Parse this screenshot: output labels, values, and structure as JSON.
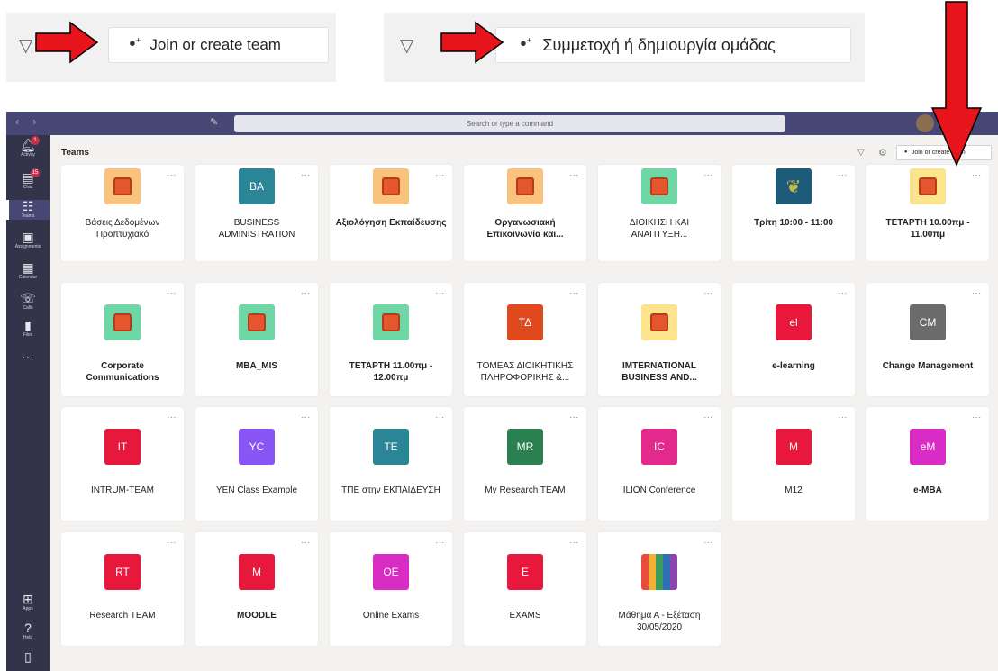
{
  "callouts": {
    "english": {
      "button_label": "Join or create team",
      "button_icon": "people-add-icon",
      "filter_icon": "filter-icon"
    },
    "greek": {
      "button_label": "Συμμετοχή ή δημιουργία ομάδας",
      "button_icon": "people-add-icon",
      "filter_icon": "filter-icon"
    }
  },
  "annotation_color": "#e8141b",
  "titlebar": {
    "search_placeholder": "Search or type a command",
    "background": "#464775"
  },
  "rail": {
    "items": [
      {
        "label": "Activity",
        "icon": "bell-icon",
        "badge": "1"
      },
      {
        "label": "Chat",
        "icon": "chat-icon",
        "badge": "15"
      },
      {
        "label": "Teams",
        "icon": "teams-icon",
        "active": true
      },
      {
        "label": "Assignments",
        "icon": "assignments-icon"
      },
      {
        "label": "Calendar",
        "icon": "calendar-icon"
      },
      {
        "label": "Calls",
        "icon": "phone-icon"
      },
      {
        "label": "Files",
        "icon": "file-icon"
      },
      {
        "label": "...",
        "icon": "more-icon"
      },
      {
        "label": "Apps",
        "icon": "apps-icon"
      },
      {
        "label": "Help",
        "icon": "help-icon"
      },
      {
        "label": "",
        "icon": "device-icon"
      }
    ]
  },
  "main": {
    "title": "Teams",
    "join_button": "Join or create team",
    "more_label": "...",
    "teams": [
      {
        "name": "Βάσεις Δεδομένων Προπτυχιακό",
        "tile": "icon",
        "color": "#f9c37e",
        "bold": false
      },
      {
        "name": "BUSINESS ADMINISTRATION",
        "tile": "text",
        "initials": "BA",
        "color": "#2a8597",
        "bold": false
      },
      {
        "name": "Αξιολόγηση Εκπαίδευσης",
        "tile": "icon",
        "color": "#f9c37e",
        "bold": true
      },
      {
        "name": "Οργανωσιακή Επικοινωνία και...",
        "tile": "icon",
        "color": "#f9c37e",
        "bold": true
      },
      {
        "name": "ΔΙΟΙΚΗΣΗ ΚΑΙ ΑΝΑΠΤΥΞΗ...",
        "tile": "icon",
        "color": "#6fd7a6",
        "bold": false
      },
      {
        "name": "Τρίτη 10:00 - 11:00",
        "tile": "image",
        "color": "#1e5a7a",
        "bold": true
      },
      {
        "name": "ΤΕΤΑΡΤΗ 10.00πμ - 11.00πμ",
        "tile": "icon",
        "color": "#fbe48c",
        "bold": true
      },
      {
        "name": "Corporate Communications",
        "tile": "icon",
        "color": "#6fd7a6",
        "bold": true
      },
      {
        "name": "MBA_MIS",
        "tile": "icon",
        "color": "#6fd7a6",
        "bold": true
      },
      {
        "name": "ΤΕΤΑΡΤΗ 11.00πμ - 12.00πμ",
        "tile": "icon",
        "color": "#6fd7a6",
        "bold": true
      },
      {
        "name": "ΤΟΜΕΑΣ ΔΙΟΙΚΗΤΙΚΗΣ ΠΛΗΡΟΦΟΡΙΚΗΣ &...",
        "tile": "text",
        "initials": "ΤΔ",
        "color": "#e0491c",
        "bold": false
      },
      {
        "name": "IMTERNATIONAL BUSINESS AND...",
        "tile": "icon",
        "color": "#fbe48c",
        "bold": true
      },
      {
        "name": "e-learning",
        "tile": "text",
        "initials": "el",
        "color": "#e8183d",
        "bold": true
      },
      {
        "name": "Change Management",
        "tile": "text",
        "initials": "CM",
        "color": "#6b6b6b",
        "bold": true
      },
      {
        "name": "INTRUM-TEAM",
        "tile": "text",
        "initials": "IT",
        "color": "#e8183d",
        "bold": false
      },
      {
        "name": "YEN Class Example",
        "tile": "text",
        "initials": "YC",
        "color": "#8a55f5",
        "bold": false
      },
      {
        "name": "ΤΠΕ στην ΕΚΠΑΙΔΕΥΣΗ",
        "tile": "text",
        "initials": "TE",
        "color": "#2a8597",
        "bold": false
      },
      {
        "name": "My Research TEAM",
        "tile": "text",
        "initials": "MR",
        "color": "#2a8050",
        "bold": false
      },
      {
        "name": "ILION Conference",
        "tile": "text",
        "initials": "IC",
        "color": "#e32a8c",
        "bold": false
      },
      {
        "name": "M12",
        "tile": "text",
        "initials": "M",
        "color": "#e8183d",
        "bold": false
      },
      {
        "name": "e-MBA",
        "tile": "text",
        "initials": "eM",
        "color": "#d82cc4",
        "bold": true
      },
      {
        "name": "Research TEAM",
        "tile": "text",
        "initials": "RT",
        "color": "#e8183d",
        "bold": false
      },
      {
        "name": "MOODLE",
        "tile": "text",
        "initials": "M",
        "color": "#e8183d",
        "bold": true
      },
      {
        "name": "Online Exams",
        "tile": "text",
        "initials": "OE",
        "color": "#d82cc4",
        "bold": false
      },
      {
        "name": "EXAMS",
        "tile": "text",
        "initials": "E",
        "color": "#e8183d",
        "bold": false
      },
      {
        "name": "Μάθημα Α - Εξέταση 30/05/2020",
        "tile": "pencils",
        "color": "#c94a3a",
        "bold": false
      }
    ]
  }
}
